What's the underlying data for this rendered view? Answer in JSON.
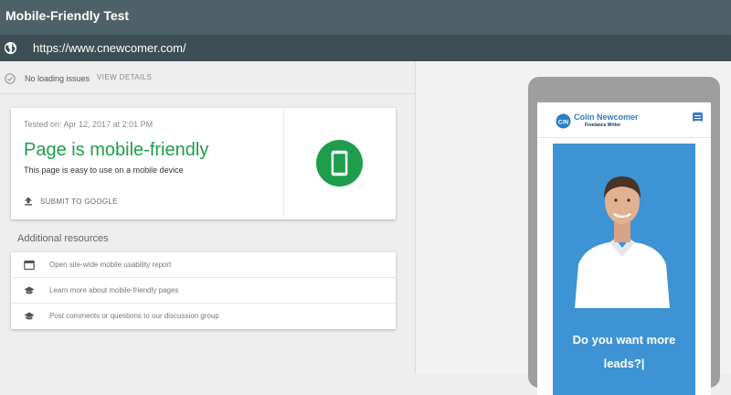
{
  "app": {
    "title": "Mobile-Friendly Test"
  },
  "url_bar": {
    "icon": "globe-icon",
    "value": "https://www.cnewcomer.com/"
  },
  "status": {
    "icon": "check-circle-icon",
    "text": "No loading issues",
    "view_details": "VIEW DETAILS"
  },
  "result": {
    "tested_on": "Tested on: Apr 12, 2017 at 2:01 PM",
    "verdict": "Page is mobile-friendly",
    "description": "This page is easy to use on a mobile device",
    "submit_label": "SUBMIT TO GOOGLE",
    "badge_icon": "smartphone-icon",
    "accent_color": "#1e9e4c"
  },
  "resources": {
    "title": "Additional resources",
    "items": [
      {
        "icon": "browser-window-icon",
        "label": "Open site-wide mobile usability report"
      },
      {
        "icon": "graduation-cap-icon",
        "label": "Learn more about mobile-friendly pages"
      },
      {
        "icon": "graduation-cap-icon",
        "label": "Post comments or questions to our discussion group"
      }
    ]
  },
  "preview": {
    "site_name": "Colin Newcomer",
    "site_tagline": "Freelance Writer",
    "logo_text": "C/N",
    "hero_heading": "Do you want more leads?|",
    "hero_color": "#3d93d4"
  }
}
